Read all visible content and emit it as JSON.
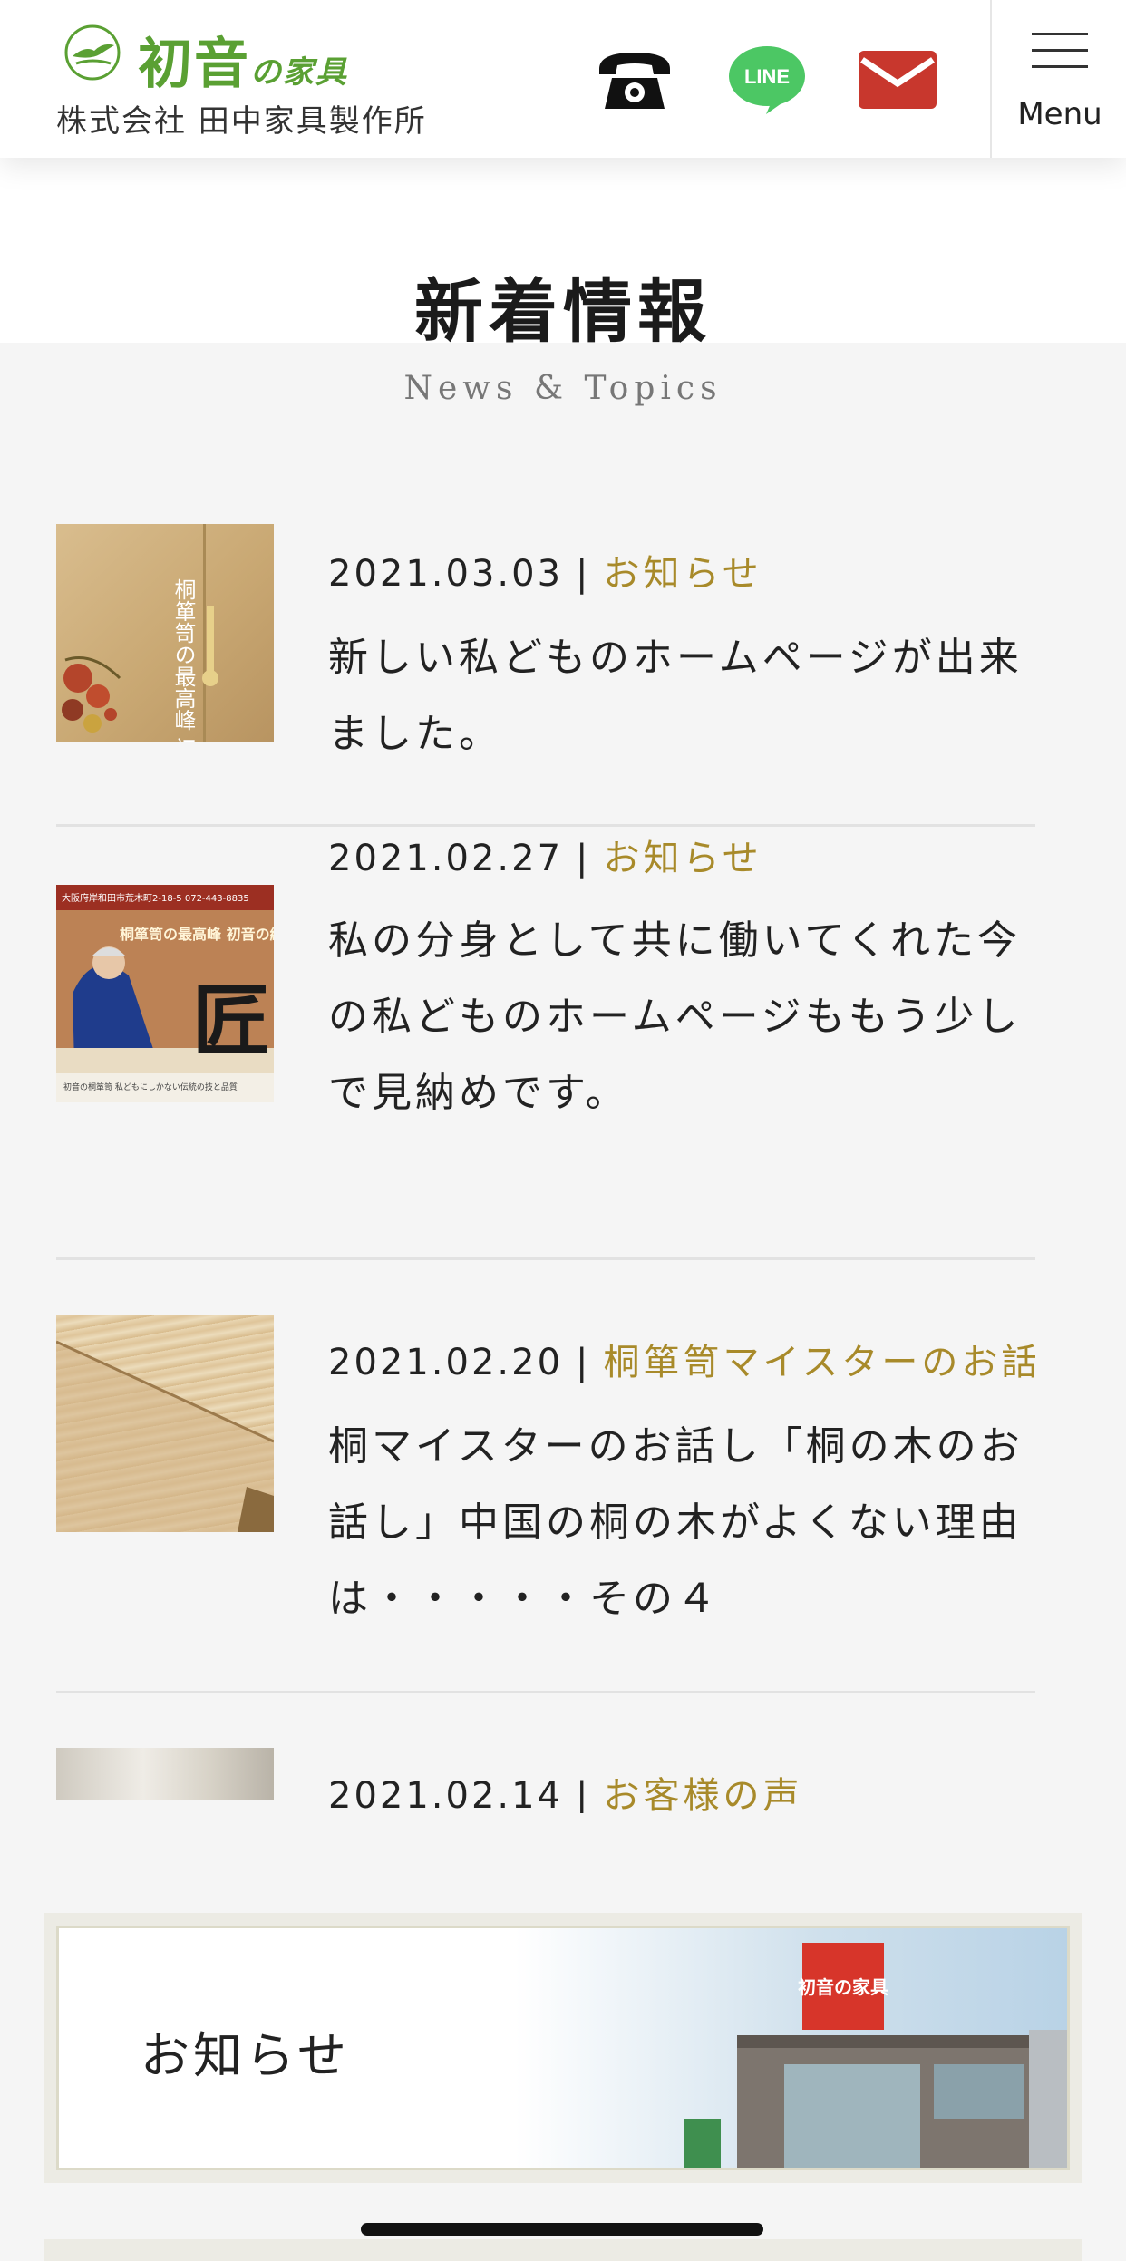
{
  "header": {
    "brand": "初音",
    "brand_small": "の家具",
    "company": "株式会社 田中家具製作所",
    "line_label": "LINE",
    "menu_label": "Menu",
    "icons": {
      "phone": "phone-icon",
      "line": "line-icon",
      "mail": "mail-icon",
      "menu": "hamburger-icon"
    },
    "colors": {
      "brand_green": "#5aa033",
      "line_green": "#4cc764",
      "mail_red": "#c8372d"
    }
  },
  "page": {
    "title": "新着情報",
    "subtitle": "News & Topics"
  },
  "news": {
    "category_color": "#a88a2a",
    "items": [
      {
        "date": "2021.03.03",
        "sep": "|",
        "category": "お知らせ",
        "text": "新しい私どものホームページが出来ました。"
      },
      {
        "date": "2021.02.27",
        "sep": "|",
        "category": "お知らせ",
        "text": "私の分身として共に働いてくれた今の私どものホームページももう少しで見納めです。"
      },
      {
        "date": "2021.02.20",
        "sep": "|",
        "category": "桐箪笥マイスターのお話",
        "text": "桐マイスターのお話し「桐の木のお話し」中国の桐の木がよくない理由は・・・・・その４"
      },
      {
        "date": "2021.02.14",
        "sep": "|",
        "category": "お客様の声",
        "text": ""
      }
    ],
    "thumb1_text": "桐箪笥の最高峰 初音の総桐箪",
    "thumb2_header": "大阪府岸和田市荒木町2-18-5  072-443-8835",
    "thumb2_title": "桐箪笥の最高峰 初音の総桐箪笥",
    "thumb2_kanji": "匠",
    "thumb2_caption": "初音の桐箪笥  私どもにしかない伝統の技と品質"
  },
  "banner": {
    "label": "お知らせ",
    "building_sign": "初音の家具"
  }
}
